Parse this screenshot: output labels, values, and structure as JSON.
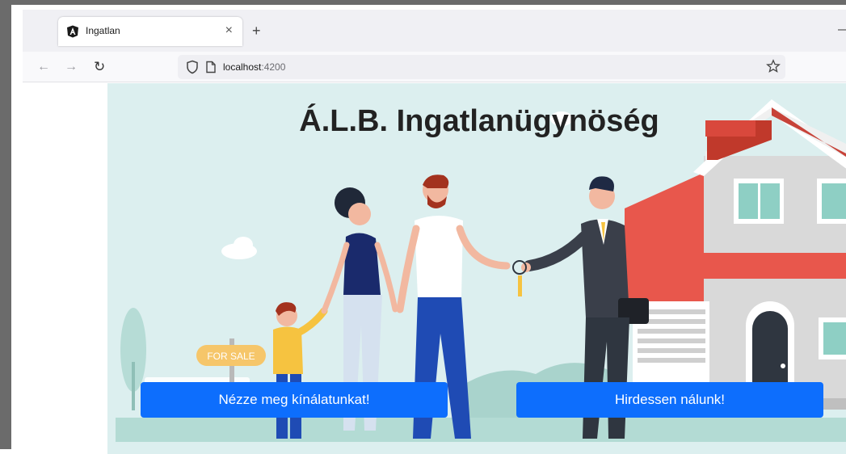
{
  "browser": {
    "tab_title": "Ingatlan",
    "tab_close": "×",
    "new_tab": "+",
    "url_host": "localhost",
    "url_port": ":4200",
    "icons": {
      "back": "arrow-left-icon",
      "forward": "arrow-right-icon",
      "reload": "reload-icon",
      "shield": "shield-icon",
      "page": "page-icon",
      "bookmark": "star-icon",
      "favicon": "angular-logo-icon"
    }
  },
  "hero": {
    "title": "Á.L.B. Ingatlanügynöség",
    "sign_text": "FOR SALE",
    "buttons": {
      "offers": "Nézze meg kínálatunkat!",
      "advertise": "Hirdessen nálunk!"
    },
    "colors": {
      "background": "#dcefef",
      "button": "#0d6efd",
      "roof": "#e05a4e",
      "house_wall": "#d3d3d3"
    }
  }
}
